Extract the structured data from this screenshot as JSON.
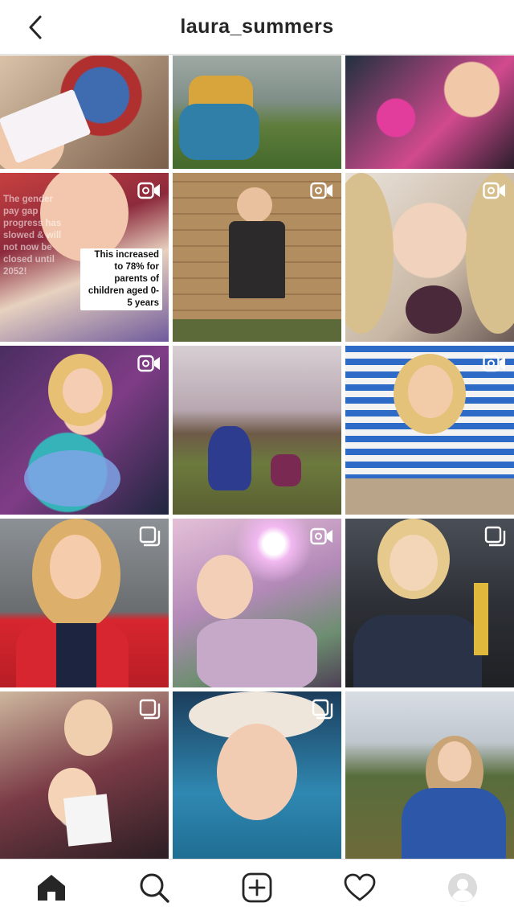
{
  "header": {
    "title": "laura_summers"
  },
  "grid": {
    "tiles": [
      {
        "type": "photo"
      },
      {
        "type": "photo"
      },
      {
        "type": "photo"
      },
      {
        "type": "video",
        "caption_left": "The gender pay gap progress has slowed & will not now be closed until 2052!",
        "caption_right": "This increased to 78% for parents of children aged 0-5 years"
      },
      {
        "type": "video"
      },
      {
        "type": "video"
      },
      {
        "type": "video"
      },
      {
        "type": "photo"
      },
      {
        "type": "video"
      },
      {
        "type": "carousel"
      },
      {
        "type": "video"
      },
      {
        "type": "carousel"
      },
      {
        "type": "carousel"
      },
      {
        "type": "carousel"
      },
      {
        "type": "photo"
      }
    ]
  },
  "nav": {
    "items": [
      "home-icon",
      "search-icon",
      "new-post-icon",
      "activity-heart-icon",
      "profile-avatar"
    ]
  },
  "colors": {
    "text": "#262626",
    "border": "#dbdbdb",
    "background": "#ffffff"
  }
}
